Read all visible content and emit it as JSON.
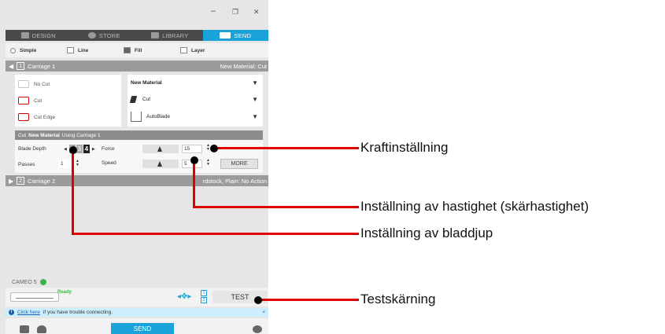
{
  "window": {
    "minimize": "–",
    "maximize": "❐",
    "close": "✕"
  },
  "tabs": [
    {
      "label": "DESIGN",
      "icon": "grid-icon"
    },
    {
      "label": "STORE",
      "icon": "store-icon"
    },
    {
      "label": "LIBRARY",
      "icon": "library-icon"
    },
    {
      "label": "SEND",
      "icon": "cutter-icon",
      "active": true
    }
  ],
  "modes": [
    "Simple",
    "Line",
    "Fill",
    "Layer"
  ],
  "carriage1": {
    "num": "1",
    "label": "Carriage 1",
    "status": "New Material: Cut"
  },
  "carriage2": {
    "num": "2",
    "label": "Carriage 2",
    "status": "rdstock, Plain: No Action"
  },
  "cut_options": [
    "No Cut",
    "Cut",
    "Cut Edge"
  ],
  "material": {
    "name": "New Material",
    "action": "Cut",
    "tool": "AutoBlade"
  },
  "settings_header": {
    "prefix": "Cut",
    "material": "New Material",
    "suffix": "Using Carriage 1"
  },
  "settings": {
    "blade_depth_label": "Blade Depth",
    "blade_depth_cells": [
      "2",
      "3",
      "4"
    ],
    "blade_depth_value": "4",
    "force_label": "Force",
    "force_value": "15",
    "passes_label": "Passes",
    "passes_value": "1",
    "speed_label": "Speed",
    "speed_value": "5",
    "more_label": "MORE"
  },
  "device": {
    "name": "CAMEO 5",
    "status": "Ready",
    "slot1": "1",
    "slot2": "2",
    "test_label": "TEST"
  },
  "help": {
    "link": "Click here",
    "text": "if you have trouble connecting.",
    "close": "×"
  },
  "send_label": "SEND",
  "callouts": {
    "force": "Kraftinställning",
    "speed": "Inställning av hastighet (skärhastighet)",
    "depth": "Inställning av bladdjup",
    "test": "Testskärning"
  },
  "colors": {
    "accent": "#1aa3d9",
    "callout_line": "#e00000",
    "ready": "#3ab54a"
  }
}
